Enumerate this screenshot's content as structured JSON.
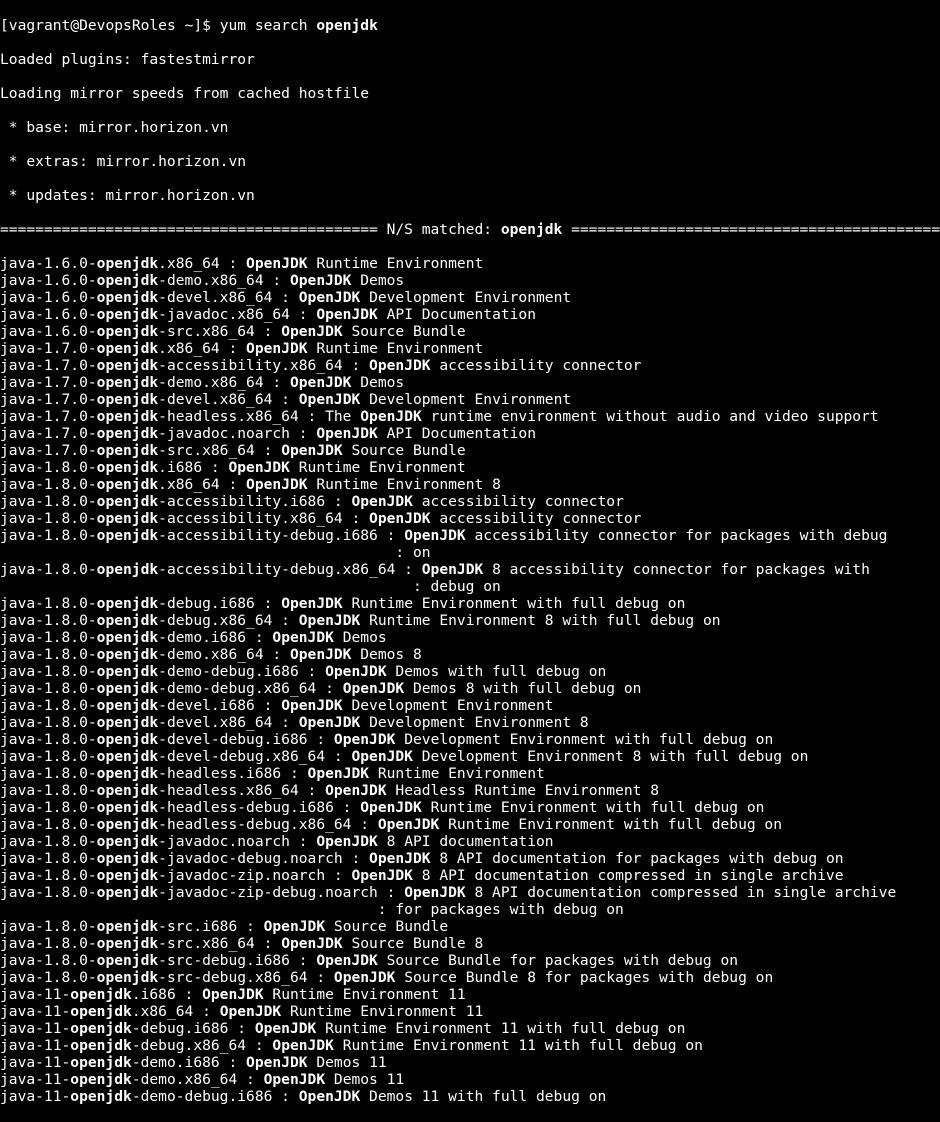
{
  "prompt": {
    "user": "vagrant",
    "host": "DevopsRoles",
    "path": "~",
    "suffix": "]$ ",
    "command_prefix": "yum search ",
    "command_term": "openjdk"
  },
  "header": {
    "plugins": "Loaded plugins: fastestmirror",
    "loading": "Loading mirror speeds from cached hostfile",
    "mirrors": [
      " * base: mirror.horizon.vn",
      " * extras: mirror.horizon.vn",
      " * updates: mirror.horizon.vn"
    ],
    "match_left": "=========================================== N/S matched: ",
    "match_term": "openjdk",
    "match_right": " ==========================================="
  },
  "rows": [
    {
      "pre": "java-1.6.0-",
      "mid": "openjdk",
      "post": ".x86_64 : ",
      "b": "OpenJDK",
      "desc": " Runtime Environment"
    },
    {
      "pre": "java-1.6.0-",
      "mid": "openjdk",
      "post": "-demo.x86_64 : ",
      "b": "OpenJDK",
      "desc": " Demos"
    },
    {
      "pre": "java-1.6.0-",
      "mid": "openjdk",
      "post": "-devel.x86_64 : ",
      "b": "OpenJDK",
      "desc": " Development Environment"
    },
    {
      "pre": "java-1.6.0-",
      "mid": "openjdk",
      "post": "-javadoc.x86_64 : ",
      "b": "OpenJDK",
      "desc": " API Documentation"
    },
    {
      "pre": "java-1.6.0-",
      "mid": "openjdk",
      "post": "-src.x86_64 : ",
      "b": "OpenJDK",
      "desc": " Source Bundle"
    },
    {
      "pre": "java-1.7.0-",
      "mid": "openjdk",
      "post": ".x86_64 : ",
      "b": "OpenJDK",
      "desc": " Runtime Environment"
    },
    {
      "pre": "java-1.7.0-",
      "mid": "openjdk",
      "post": "-accessibility.x86_64 : ",
      "b": "OpenJDK",
      "desc": " accessibility connector"
    },
    {
      "pre": "java-1.7.0-",
      "mid": "openjdk",
      "post": "-demo.x86_64 : ",
      "b": "OpenJDK",
      "desc": " Demos"
    },
    {
      "pre": "java-1.7.0-",
      "mid": "openjdk",
      "post": "-devel.x86_64 : ",
      "b": "OpenJDK",
      "desc": " Development Environment"
    },
    {
      "pre": "java-1.7.0-",
      "mid": "openjdk",
      "post": "-headless.x86_64 : The ",
      "b": "OpenJDK",
      "desc": " runtime environment without audio and video support"
    },
    {
      "pre": "java-1.7.0-",
      "mid": "openjdk",
      "post": "-javadoc.noarch : ",
      "b": "OpenJDK",
      "desc": " API Documentation"
    },
    {
      "pre": "java-1.7.0-",
      "mid": "openjdk",
      "post": "-src.x86_64 : ",
      "b": "OpenJDK",
      "desc": " Source Bundle"
    },
    {
      "pre": "java-1.8.0-",
      "mid": "openjdk",
      "post": ".i686 : ",
      "b": "OpenJDK",
      "desc": " Runtime Environment"
    },
    {
      "pre": "java-1.8.0-",
      "mid": "openjdk",
      "post": ".x86_64 : ",
      "b": "OpenJDK",
      "desc": " Runtime Environment 8"
    },
    {
      "pre": "java-1.8.0-",
      "mid": "openjdk",
      "post": "-accessibility.i686 : ",
      "b": "OpenJDK",
      "desc": " accessibility connector"
    },
    {
      "pre": "java-1.8.0-",
      "mid": "openjdk",
      "post": "-accessibility.x86_64 : ",
      "b": "OpenJDK",
      "desc": " accessibility connector"
    },
    {
      "pre": "java-1.8.0-",
      "mid": "openjdk",
      "post": "-accessibility-debug.i686 : ",
      "b": "OpenJDK",
      "desc": " accessibility connector for packages with debug",
      "cont": "                                             : on"
    },
    {
      "pre": "java-1.8.0-",
      "mid": "openjdk",
      "post": "-accessibility-debug.x86_64 : ",
      "b": "OpenJDK",
      "desc": " 8 accessibility connector for packages with",
      "cont": "                                               : debug on"
    },
    {
      "pre": "java-1.8.0-",
      "mid": "openjdk",
      "post": "-debug.i686 : ",
      "b": "OpenJDK",
      "desc": " Runtime Environment with full debug on"
    },
    {
      "pre": "java-1.8.0-",
      "mid": "openjdk",
      "post": "-debug.x86_64 : ",
      "b": "OpenJDK",
      "desc": " Runtime Environment 8 with full debug on"
    },
    {
      "pre": "java-1.8.0-",
      "mid": "openjdk",
      "post": "-demo.i686 : ",
      "b": "OpenJDK",
      "desc": " Demos"
    },
    {
      "pre": "java-1.8.0-",
      "mid": "openjdk",
      "post": "-demo.x86_64 : ",
      "b": "OpenJDK",
      "desc": " Demos 8"
    },
    {
      "pre": "java-1.8.0-",
      "mid": "openjdk",
      "post": "-demo-debug.i686 : ",
      "b": "OpenJDK",
      "desc": " Demos with full debug on"
    },
    {
      "pre": "java-1.8.0-",
      "mid": "openjdk",
      "post": "-demo-debug.x86_64 : ",
      "b": "OpenJDK",
      "desc": " Demos 8 with full debug on"
    },
    {
      "pre": "java-1.8.0-",
      "mid": "openjdk",
      "post": "-devel.i686 : ",
      "b": "OpenJDK",
      "desc": " Development Environment"
    },
    {
      "pre": "java-1.8.0-",
      "mid": "openjdk",
      "post": "-devel.x86_64 : ",
      "b": "OpenJDK",
      "desc": " Development Environment 8"
    },
    {
      "pre": "java-1.8.0-",
      "mid": "openjdk",
      "post": "-devel-debug.i686 : ",
      "b": "OpenJDK",
      "desc": " Development Environment with full debug on"
    },
    {
      "pre": "java-1.8.0-",
      "mid": "openjdk",
      "post": "-devel-debug.x86_64 : ",
      "b": "OpenJDK",
      "desc": " Development Environment 8 with full debug on"
    },
    {
      "pre": "java-1.8.0-",
      "mid": "openjdk",
      "post": "-headless.i686 : ",
      "b": "OpenJDK",
      "desc": " Runtime Environment"
    },
    {
      "pre": "java-1.8.0-",
      "mid": "openjdk",
      "post": "-headless.x86_64 : ",
      "b": "OpenJDK",
      "desc": " Headless Runtime Environment 8"
    },
    {
      "pre": "java-1.8.0-",
      "mid": "openjdk",
      "post": "-headless-debug.i686 : ",
      "b": "OpenJDK",
      "desc": " Runtime Environment with full debug on"
    },
    {
      "pre": "java-1.8.0-",
      "mid": "openjdk",
      "post": "-headless-debug.x86_64 : ",
      "b": "OpenJDK",
      "desc": " Runtime Environment with full debug on"
    },
    {
      "pre": "java-1.8.0-",
      "mid": "openjdk",
      "post": "-javadoc.noarch : ",
      "b": "OpenJDK",
      "desc": " 8 API documentation"
    },
    {
      "pre": "java-1.8.0-",
      "mid": "openjdk",
      "post": "-javadoc-debug.noarch : ",
      "b": "OpenJDK",
      "desc": " 8 API documentation for packages with debug on"
    },
    {
      "pre": "java-1.8.0-",
      "mid": "openjdk",
      "post": "-javadoc-zip.noarch : ",
      "b": "OpenJDK",
      "desc": " 8 API documentation compressed in single archive"
    },
    {
      "pre": "java-1.8.0-",
      "mid": "openjdk",
      "post": "-javadoc-zip-debug.noarch : ",
      "b": "OpenJDK",
      "desc": " 8 API documentation compressed in single archive",
      "cont": "                                           : for packages with debug on"
    },
    {
      "pre": "java-1.8.0-",
      "mid": "openjdk",
      "post": "-src.i686 : ",
      "b": "OpenJDK",
      "desc": " Source Bundle"
    },
    {
      "pre": "java-1.8.0-",
      "mid": "openjdk",
      "post": "-src.x86_64 : ",
      "b": "OpenJDK",
      "desc": " Source Bundle 8"
    },
    {
      "pre": "java-1.8.0-",
      "mid": "openjdk",
      "post": "-src-debug.i686 : ",
      "b": "OpenJDK",
      "desc": " Source Bundle for packages with debug on"
    },
    {
      "pre": "java-1.8.0-",
      "mid": "openjdk",
      "post": "-src-debug.x86_64 : ",
      "b": "OpenJDK",
      "desc": " Source Bundle 8 for packages with debug on"
    },
    {
      "pre": "java-11-",
      "mid": "openjdk",
      "post": ".i686 : ",
      "b": "OpenJDK",
      "desc": " Runtime Environment 11"
    },
    {
      "pre": "java-11-",
      "mid": "openjdk",
      "post": ".x86_64 : ",
      "b": "OpenJDK",
      "desc": " Runtime Environment 11"
    },
    {
      "pre": "java-11-",
      "mid": "openjdk",
      "post": "-debug.i686 : ",
      "b": "OpenJDK",
      "desc": " Runtime Environment 11 with full debug on"
    },
    {
      "pre": "java-11-",
      "mid": "openjdk",
      "post": "-debug.x86_64 : ",
      "b": "OpenJDK",
      "desc": " Runtime Environment 11 with full debug on"
    },
    {
      "pre": "java-11-",
      "mid": "openjdk",
      "post": "-demo.i686 : ",
      "b": "OpenJDK",
      "desc": " Demos 11"
    },
    {
      "pre": "java-11-",
      "mid": "openjdk",
      "post": "-demo.x86_64 : ",
      "b": "OpenJDK",
      "desc": " Demos 11"
    },
    {
      "pre": "java-11-",
      "mid": "openjdk",
      "post": "-demo-debug.i686 : ",
      "b": "OpenJDK",
      "desc": " Demos 11 with full debug on"
    }
  ]
}
